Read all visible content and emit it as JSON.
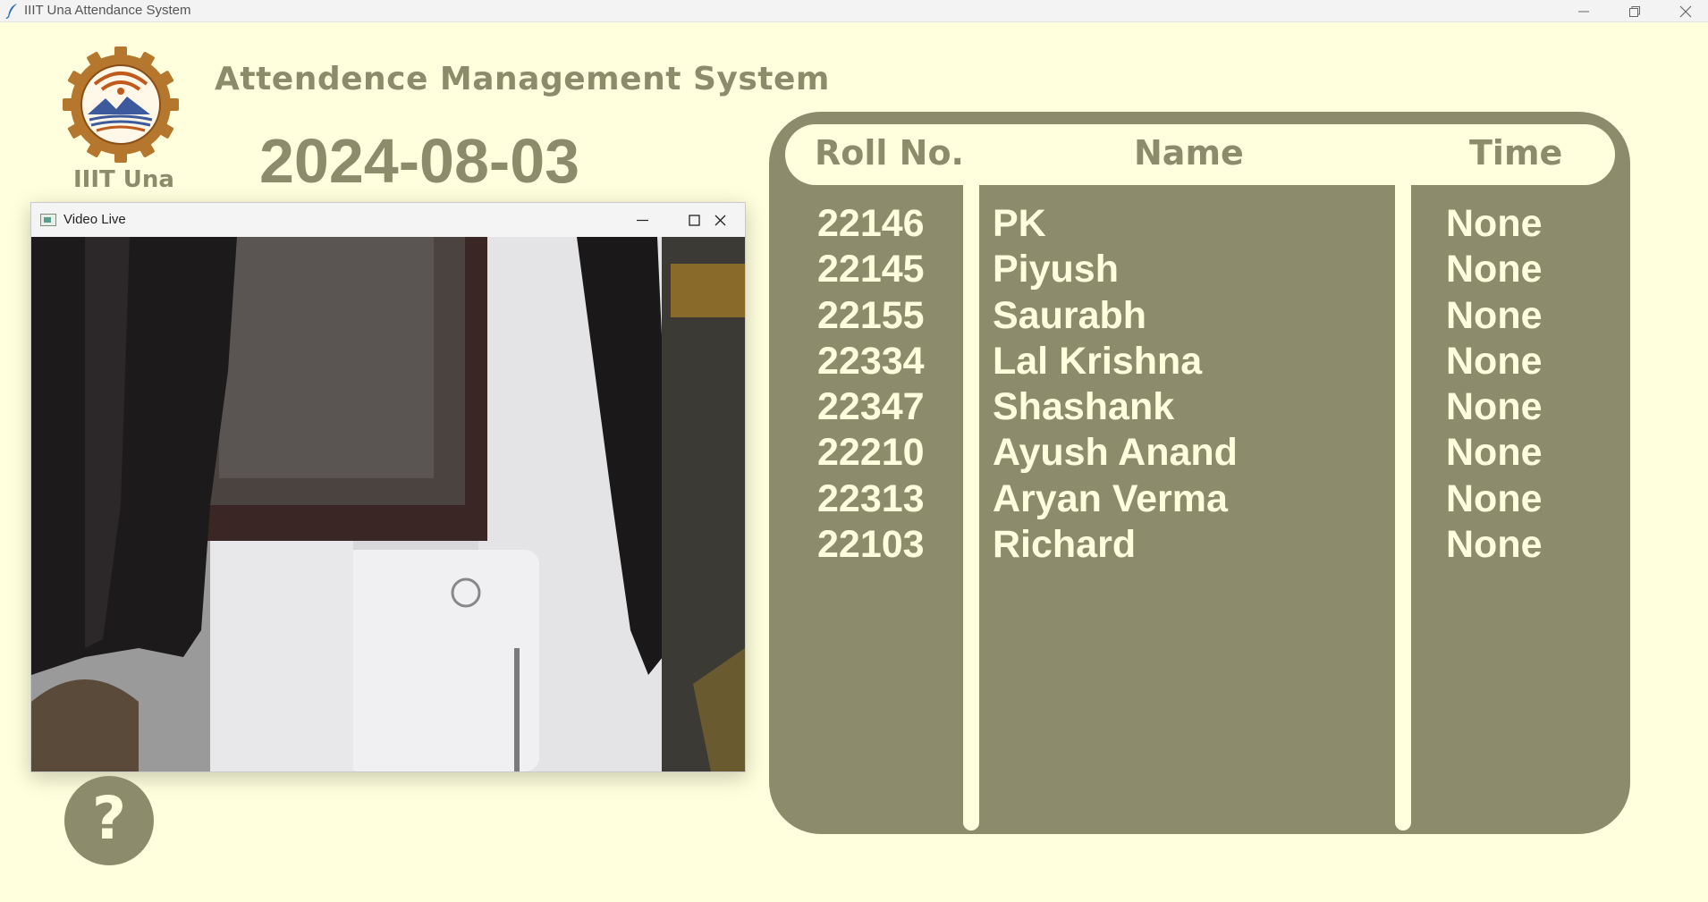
{
  "window": {
    "title": "IIIT Una Attendance System"
  },
  "header": {
    "logo_text": "IIIT Una",
    "app_heading": "Attendence Management System",
    "date": "2024-08-03"
  },
  "video_window": {
    "title": "Video Live"
  },
  "help_button": {
    "label": "?"
  },
  "table": {
    "columns": [
      "Roll No.",
      "Name",
      "Time"
    ],
    "rows": [
      {
        "roll": "22146",
        "name": "PK",
        "time": "None"
      },
      {
        "roll": "22145",
        "name": "Piyush",
        "time": "None"
      },
      {
        "roll": "22155",
        "name": "Saurabh",
        "time": "None"
      },
      {
        "roll": "22334",
        "name": "Lal Krishna",
        "time": "None"
      },
      {
        "roll": "22347",
        "name": "Shashank",
        "time": "None"
      },
      {
        "roll": "22210",
        "name": "Ayush Anand",
        "time": "None"
      },
      {
        "roll": "22313",
        "name": "Aryan Verma",
        "time": "None"
      },
      {
        "roll": "22103",
        "name": "Richard",
        "time": "None"
      }
    ]
  },
  "colors": {
    "background": "#ffffdd",
    "accent": "#8c8c6c"
  },
  "icons": [
    "feather-icon",
    "minimize-icon",
    "restore-icon",
    "close-icon",
    "video-app-icon",
    "maximize-icon",
    "question-icon",
    "institute-logo"
  ]
}
